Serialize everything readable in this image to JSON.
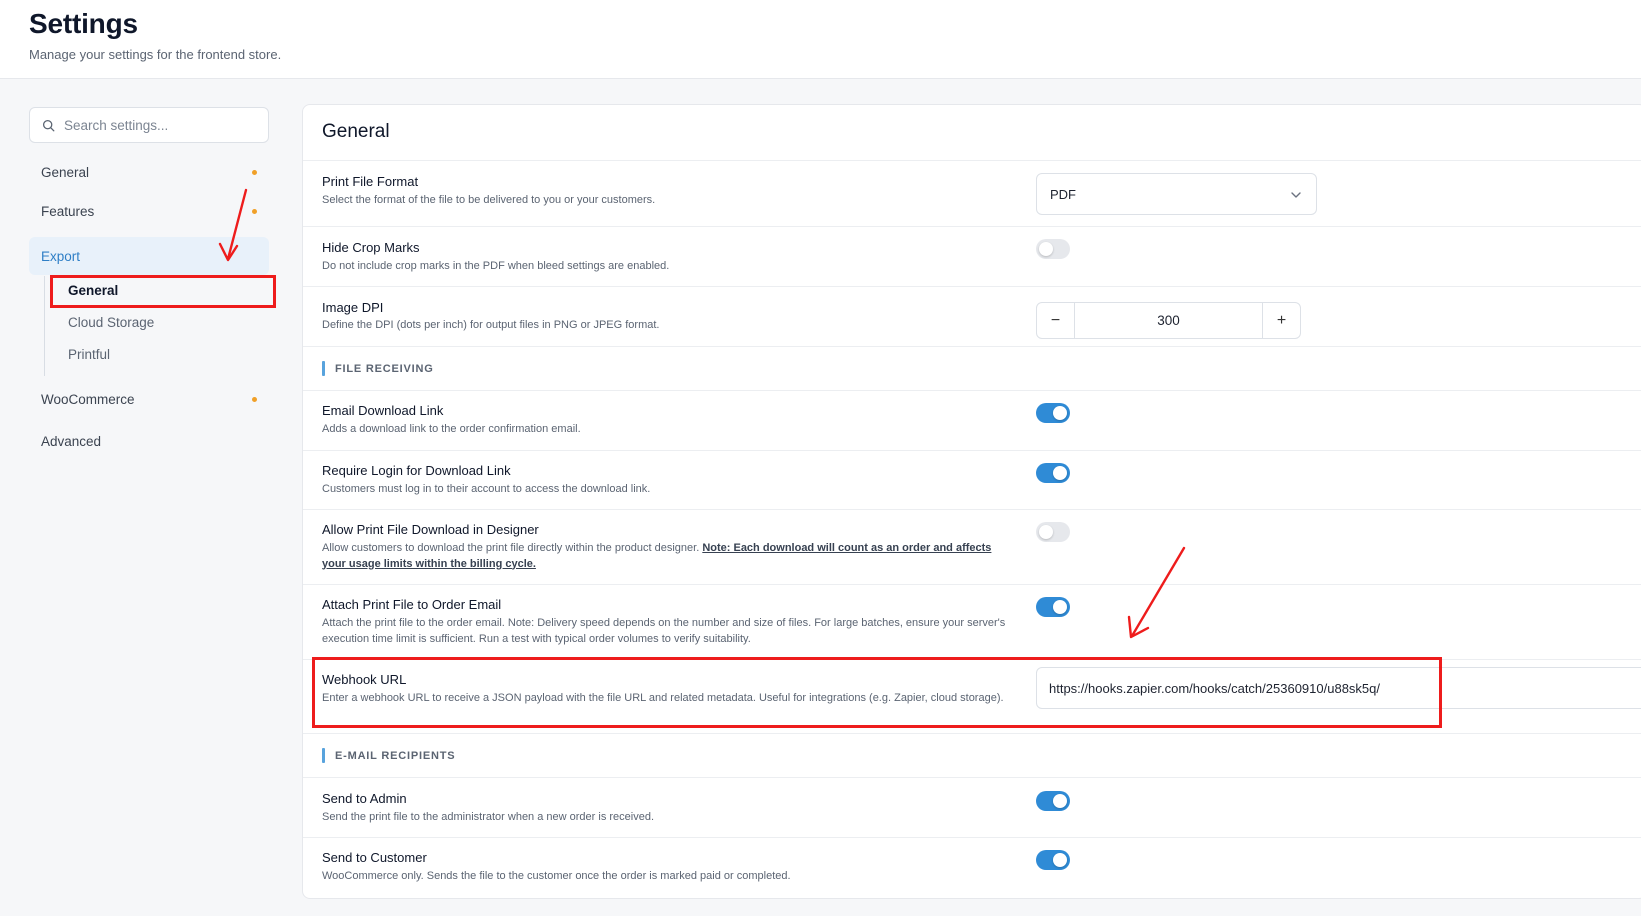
{
  "header": {
    "title": "Settings",
    "subtitle": "Manage your settings for the frontend store."
  },
  "sidebar": {
    "search_placeholder": "Search settings...",
    "items": [
      {
        "label": "General",
        "indicator": true
      },
      {
        "label": "Features",
        "indicator": true
      },
      {
        "label": "Export",
        "active": true
      },
      {
        "label": "WooCommerce",
        "indicator": true
      },
      {
        "label": "Advanced"
      }
    ],
    "export_children": [
      {
        "label": "General",
        "current": true
      },
      {
        "label": "Cloud Storage"
      },
      {
        "label": "Printful"
      }
    ]
  },
  "panel": {
    "title": "General",
    "print_format": {
      "title": "Print File Format",
      "desc": "Select the format of the file to be delivered to you or your customers.",
      "value": "PDF"
    },
    "crop_marks": {
      "title": "Hide Crop Marks",
      "desc": "Do not include crop marks in the PDF when bleed settings are enabled.",
      "enabled": false
    },
    "image_dpi": {
      "title": "Image DPI",
      "desc": "Define the DPI (dots per inch) for output files in PNG or JPEG format.",
      "value": "300",
      "minus": "−",
      "plus": "+"
    },
    "section_file_receiving": "FILE RECEIVING",
    "email_download": {
      "title": "Email Download Link",
      "desc": "Adds a download link to the order confirmation email.",
      "enabled": true
    },
    "require_login": {
      "title": "Require Login for Download Link",
      "desc": "Customers must log in to their account to access the download link.",
      "enabled": true
    },
    "allow_download": {
      "title": "Allow Print File Download in Designer",
      "desc": "Allow customers to download the print file directly within the product designer.",
      "note": "Note: Each download will count as an order and affects your usage limits within the billing cycle.",
      "enabled": false
    },
    "attach_print": {
      "title": "Attach Print File to Order Email",
      "desc": "Attach the print file to the order email. Note: Delivery speed depends on the number and size of files. For large batches, ensure your server's execution time limit is sufficient. Run a test with typical order volumes to verify suitability.",
      "enabled": true
    },
    "webhook": {
      "title": "Webhook URL",
      "desc": "Enter a webhook URL to receive a JSON payload with the file URL and related metadata. Useful for integrations (e.g. Zapier, cloud storage).",
      "value": "https://hooks.zapier.com/hooks/catch/25360910/u88sk5q/"
    },
    "section_email_recipients": "E-MAIL RECIPIENTS",
    "send_admin": {
      "title": "Send to Admin",
      "desc": "Send the print file to the administrator when a new order is received.",
      "enabled": true
    },
    "send_customer": {
      "title": "Send to Customer",
      "desc": "WooCommerce only. Sends the file to the customer once the order is marked paid or completed.",
      "enabled": true
    }
  },
  "colors": {
    "accent": "#2f8bd6",
    "indicator": "#f0a028",
    "annotation": "#ee1c1c"
  }
}
